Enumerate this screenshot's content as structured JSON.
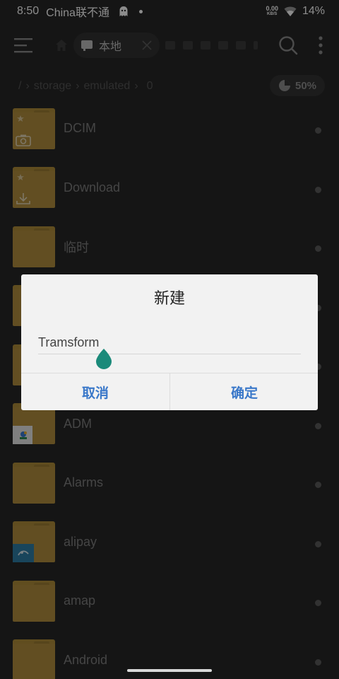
{
  "status_bar": {
    "time": "8:50",
    "carrier": "China联不通",
    "net_speed_value": "0.00",
    "net_speed_unit": "KB/S",
    "battery": "14%"
  },
  "toolbar": {
    "tab_label": "本地",
    "icons": [
      "menu-icon",
      "home-icon",
      "sd-card-icon",
      "close-icon",
      "search-icon",
      "more-icon"
    ]
  },
  "breadcrumb": {
    "root": "/",
    "items": [
      "storage",
      "emulated",
      "0"
    ]
  },
  "storage_usage": "50%",
  "files": [
    {
      "name": "DCIM",
      "badge": "camera"
    },
    {
      "name": "Download",
      "badge": "download"
    },
    {
      "name": "临时",
      "badge": ""
    },
    {
      "name": "",
      "badge": ""
    },
    {
      "name": "",
      "badge": ""
    },
    {
      "name": "ADM",
      "badge": "app"
    },
    {
      "name": "Alarms",
      "badge": ""
    },
    {
      "name": "alipay",
      "badge": "alipay"
    },
    {
      "name": "amap",
      "badge": ""
    },
    {
      "name": "Android",
      "badge": ""
    }
  ],
  "dialog": {
    "title": "新建",
    "input_value": "Tramsform",
    "cancel_label": "取消",
    "ok_label": "确定"
  },
  "colors": {
    "background": "#272727",
    "folder": "#b38f3e",
    "dialog_bg": "#f2f2f2",
    "dialog_button": "#3a78c9",
    "cursor_handle": "#1b8a7a"
  }
}
